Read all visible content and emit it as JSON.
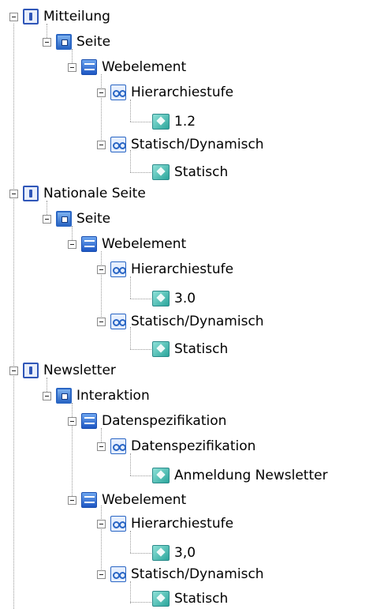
{
  "tree": [
    {
      "label": "Mitteilung",
      "children": [
        {
          "label": "Seite",
          "children": [
            {
              "label": "Webelement",
              "children": [
                {
                  "label": "Hierarchiestufe",
                  "children": [
                    {
                      "label": "1.2"
                    }
                  ]
                },
                {
                  "label": "Statisch/Dynamisch",
                  "children": [
                    {
                      "label": "Statisch"
                    }
                  ]
                }
              ]
            }
          ]
        }
      ]
    },
    {
      "label": "Nationale Seite",
      "children": [
        {
          "label": "Seite",
          "children": [
            {
              "label": "Webelement",
              "children": [
                {
                  "label": "Hierarchiestufe",
                  "children": [
                    {
                      "label": "3.0"
                    }
                  ]
                },
                {
                  "label": "Statisch/Dynamisch",
                  "children": [
                    {
                      "label": "Statisch"
                    }
                  ]
                }
              ]
            }
          ]
        }
      ]
    },
    {
      "label": "Newsletter",
      "children": [
        {
          "label": "Interaktion",
          "children": [
            {
              "label": "Datenspezifikation",
              "children": [
                {
                  "label": "Datenspezifikation",
                  "children": [
                    {
                      "label": "Anmeldung Newsletter"
                    }
                  ]
                }
              ]
            },
            {
              "label": "Webelement",
              "children": [
                {
                  "label": "Hierarchiestufe",
                  "children": [
                    {
                      "label": "3,0"
                    }
                  ]
                },
                {
                  "label": "Statisch/Dynamisch",
                  "children": [
                    {
                      "label": "Statisch"
                    }
                  ]
                }
              ]
            }
          ]
        }
      ]
    }
  ]
}
